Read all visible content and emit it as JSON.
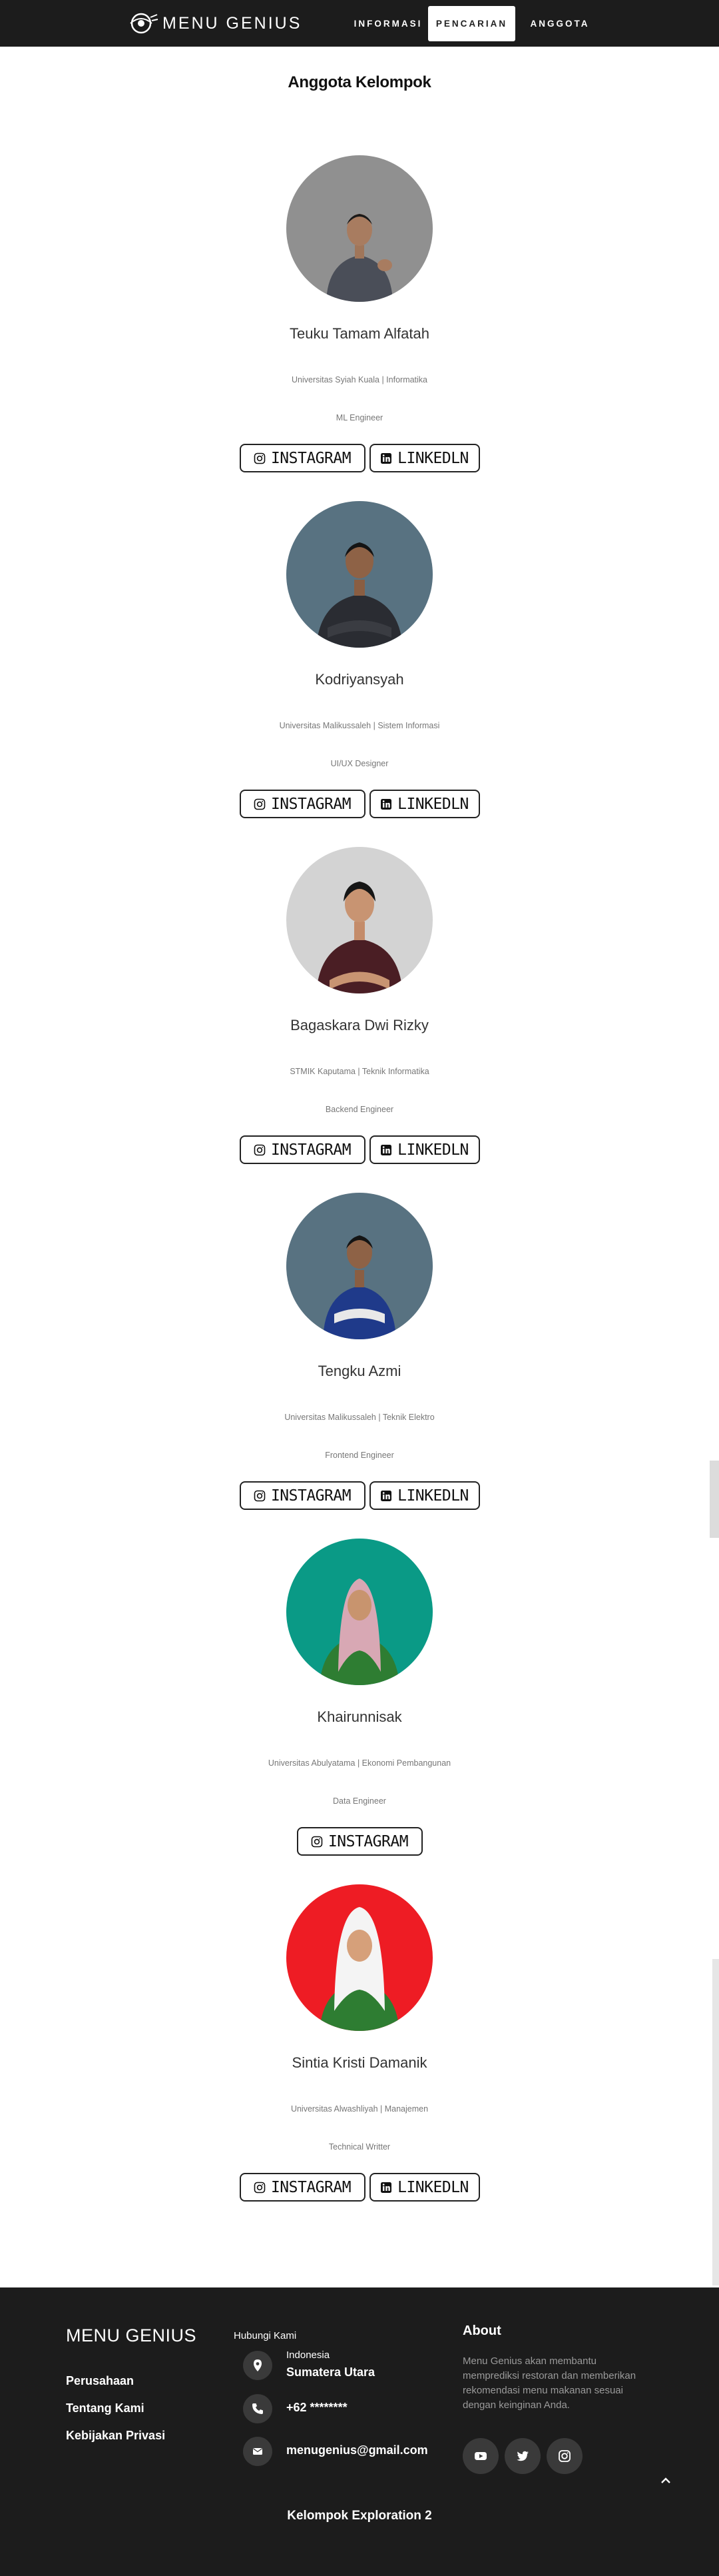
{
  "navbar": {
    "brand": "MENU GENIUS",
    "items": [
      "INFORMASI",
      "PENCARIAN",
      "ANGGOTA"
    ],
    "active": "PENCARIAN"
  },
  "section_title": "Anggota Kelompok",
  "members": [
    {
      "name": "Teuku Tamam Alfatah",
      "university": "Universitas Syiah Kuala | Informatika",
      "role": "ML Engineer",
      "instagram_label": "INSTAGRAM",
      "linkedin_label": "LINKEDLN",
      "photo_bg": "#909090"
    },
    {
      "name": "Kodriyansyah",
      "university": "Universitas Malikussaleh | Sistem Informasi",
      "role": "UI/UX Designer",
      "instagram_label": "INSTAGRAM",
      "linkedin_label": "LINKEDLN",
      "photo_bg": "#587281"
    },
    {
      "name": "Bagaskara Dwi Rizky",
      "university": "STMIK Kaputama | Teknik Informatika",
      "role": "Backend Engineer",
      "instagram_label": "INSTAGRAM",
      "linkedin_label": "LINKEDLN",
      "photo_bg": "#d3d3d3"
    },
    {
      "name": "Tengku Azmi",
      "university": "Universitas Malikussaleh | Teknik Elektro",
      "role": "Frontend Engineer",
      "instagram_label": "INSTAGRAM",
      "linkedin_label": "LINKEDLN",
      "photo_bg": "#587281"
    },
    {
      "name": "Khairunnisak",
      "university": "Universitas Abulyatama | Ekonomi Pembangunan",
      "role": "Data Engineer",
      "instagram_label": "INSTAGRAM",
      "linkedin_label": null,
      "photo_bg": "#0a9a86"
    },
    {
      "name": "Sintia Kristi Damanik",
      "university": "Universitas Alwashliyah | Manajemen",
      "role": "Technical Writter",
      "instagram_label": "INSTAGRAM",
      "linkedin_label": "LINKEDLN",
      "photo_bg": "#ee1c24"
    }
  ],
  "footer": {
    "brand": "MENU GENIUS",
    "links": [
      "Perusahaan",
      "Tentang Kami",
      "Kebijakan Privasi"
    ],
    "contact_title": "Hubungi Kami",
    "location_line1": "Indonesia",
    "location_line2": "Sumatera Utara",
    "phone": "+62 ********",
    "email": "menugenius@gmail.com",
    "about_title": "About",
    "about_text": "Menu Genius akan membantu memprediksi restoran dan memberikan rekomendasi menu makanan sesuai dengan keinginan Anda.",
    "social_icons": [
      "youtube-icon",
      "twitter-icon",
      "instagram-icon"
    ],
    "copyright": "Kelompok Exploration 2"
  },
  "colors": {
    "navbar_bg": "#1c1c1c",
    "footer_bg": "#1c1c1c",
    "text_muted": "#777777"
  }
}
